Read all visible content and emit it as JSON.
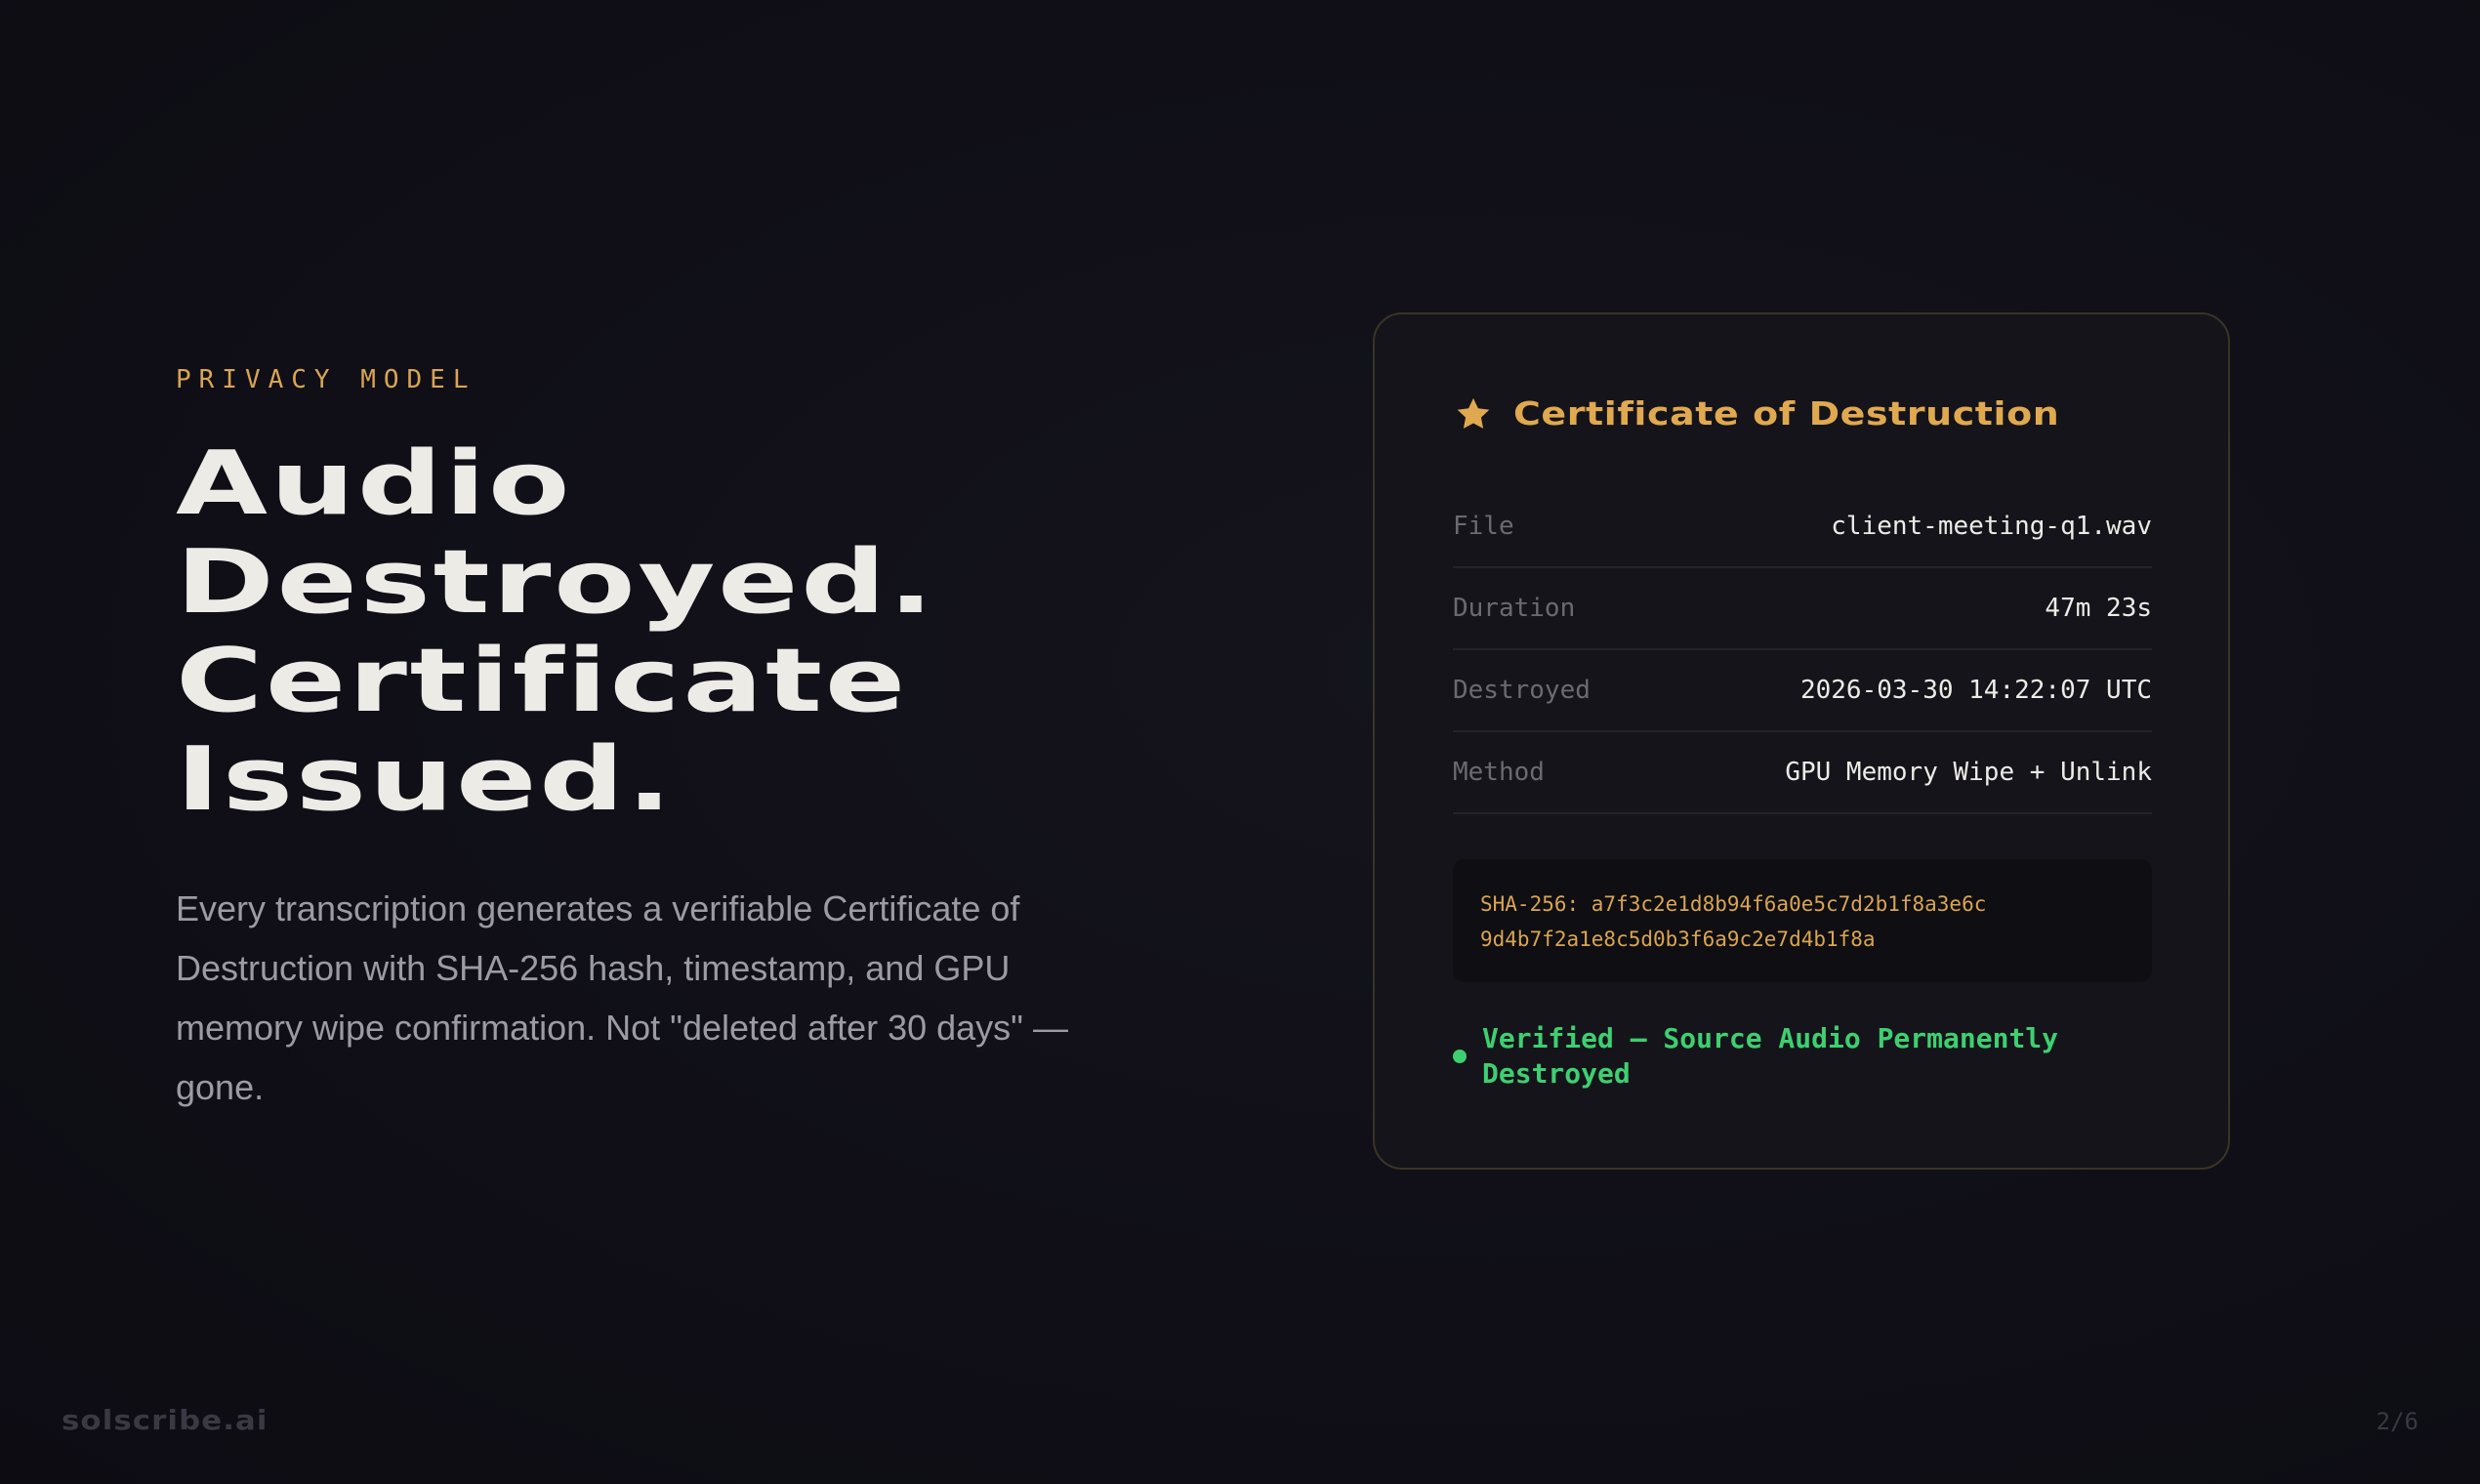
{
  "eyebrow": "PRIVACY MODEL",
  "headline": {
    "line1": "Audio",
    "line2": "Destroyed.",
    "line3": "Certificate",
    "line4": "Issued."
  },
  "body": "Every transcription generates a verifiable Certificate of Destruction with SHA-256 hash, timestamp, and GPU memory wipe confirmation. Not \"deleted after 30 days\" — gone.",
  "certificate": {
    "icon": "star-icon",
    "title": "Certificate of Destruction",
    "rows": [
      {
        "label": "File",
        "value": "client-meeting-q1.wav"
      },
      {
        "label": "Duration",
        "value": "47m 23s"
      },
      {
        "label": "Destroyed",
        "value": "2026-03-30 14:22:07 UTC"
      },
      {
        "label": "Method",
        "value": "GPU Memory Wipe + Unlink"
      }
    ],
    "hash_line1": "SHA-256: a7f3c2e1d8b94f6a0e5c7d2b1f8a3e6c",
    "hash_line2": "9d4b7f2a1e8c5d0b3f6a9c2e7d4b1f8a",
    "status": "Verified — Source Audio Permanently Destroyed"
  },
  "footer": {
    "brand": "solscribe.ai",
    "page": "2/6"
  },
  "colors": {
    "accent": "#d9a552",
    "success": "#3ecf71",
    "background": "#100f17",
    "card": "#15141a",
    "headline": "#ecebe6"
  }
}
